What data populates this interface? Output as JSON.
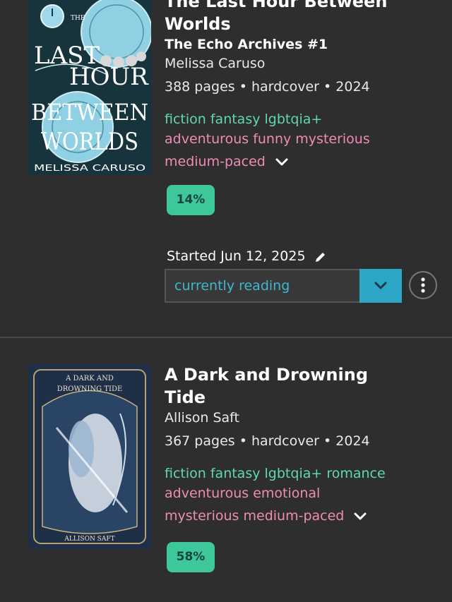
{
  "books": [
    {
      "cover_alt": "The Last Hour Between Worlds cover",
      "cover_text": {
        "the": "THE",
        "l1": "LAST",
        "l2": "HOUR",
        "l3": "BETWEEN",
        "l4": "WORLDS",
        "author": "MELISSA CARUSO"
      },
      "title": "The Last Hour Between Worlds",
      "series": "The Echo Archives #1",
      "author": "Melissa Caruso",
      "meta": "388 pages • hardcover • 2024",
      "genres": [
        "fiction",
        "fantasy",
        "lgbtqia+"
      ],
      "moods": [
        "adventurous",
        "funny",
        "mysterious",
        "medium-paced"
      ],
      "progress": "14%",
      "started": "Started Jun 12, 2025",
      "status": "currently reading"
    },
    {
      "cover_alt": "A Dark and Drowning Tide cover",
      "cover_text": {
        "t1": "A DARK AND",
        "t2": "DROWNING TIDE",
        "author": "ALLISON SAFT"
      },
      "title": "A Dark and Drowning Tide",
      "author": "Allison Saft",
      "meta": "367 pages • hardcover • 2024",
      "genres": [
        "fiction",
        "fantasy",
        "lgbtqia+",
        "romance"
      ],
      "moods": [
        "adventurous",
        "emotional",
        "mysterious",
        "medium-paced"
      ],
      "progress": "58%"
    }
  ],
  "colors": {
    "background": "#2e2e2e",
    "genre": "#5fd8b0",
    "mood": "#ef8cb5",
    "progress": "#3ec79a",
    "status_text": "#3fb8cf",
    "status_button": "#2ea6c8"
  },
  "icons": [
    "chevron-down-icon",
    "pencil-icon",
    "more-vertical-icon"
  ]
}
